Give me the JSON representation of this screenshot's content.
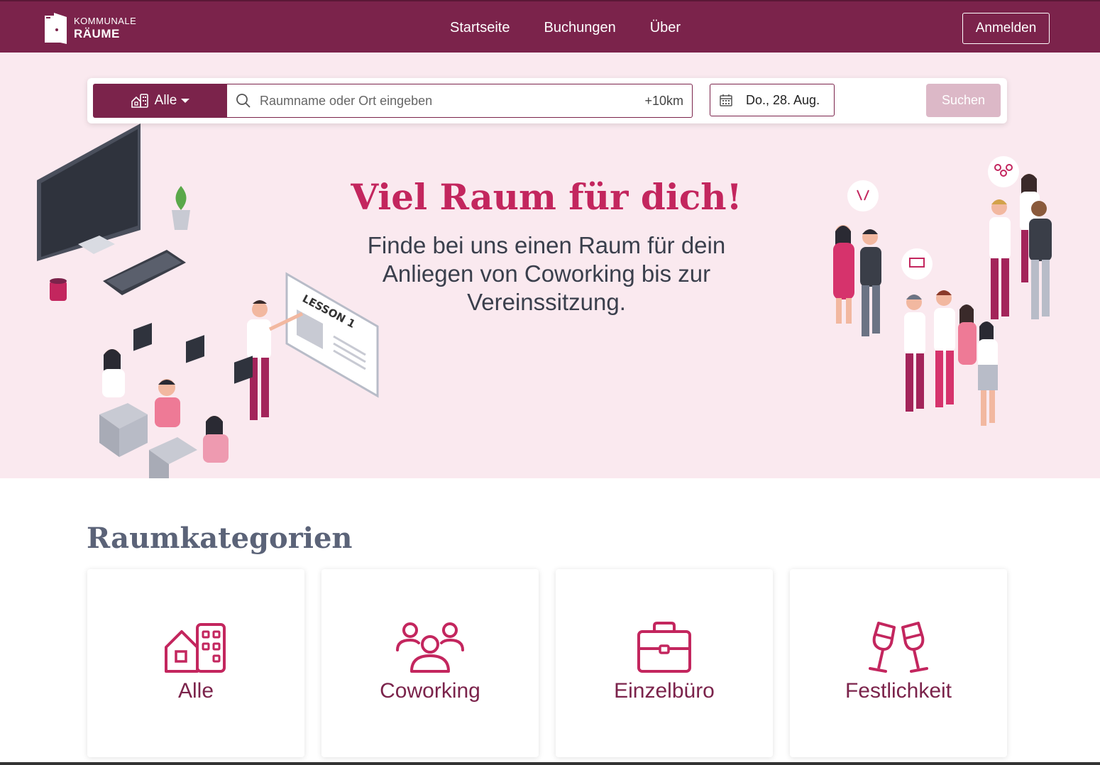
{
  "header": {
    "logo_small": "KOMMUNALE",
    "logo_big": "RÄUME",
    "nav": [
      {
        "label": "Startseite",
        "active": true
      },
      {
        "label": "Buchungen",
        "active": false
      },
      {
        "label": "Über",
        "active": false
      }
    ],
    "login_label": "Anmelden"
  },
  "search": {
    "category_label": "Alle",
    "placeholder": "Raumname oder Ort eingeben",
    "radius": "+10km",
    "date": "Do., 28. Aug.",
    "button_label": "Suchen"
  },
  "hero": {
    "title": "Viel Raum für dich!",
    "subtitle": "Finde bei uns einen Raum für dein Anliegen von Coworking bis zur Vereinssitzung.",
    "board_text": "LESSON 1"
  },
  "categories": {
    "heading": "Raumkategorien",
    "items": [
      {
        "label": "Alle",
        "icon": "buildings-icon"
      },
      {
        "label": "Coworking",
        "icon": "people-group-icon"
      },
      {
        "label": "Einzelbüro",
        "icon": "briefcase-icon"
      },
      {
        "label": "Festlichkeit",
        "icon": "champagne-glasses-icon"
      }
    ]
  },
  "colors": {
    "brand": "#7b234b",
    "accent": "#c3265e",
    "hero_bg": "#fae9ef",
    "button_disabled": "#dcb8c7"
  }
}
